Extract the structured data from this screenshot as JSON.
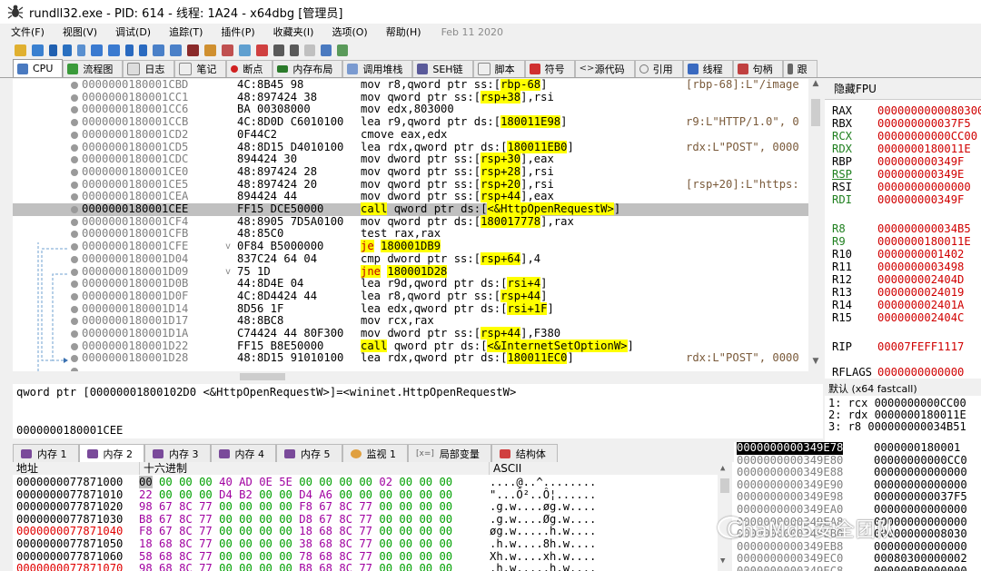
{
  "title": "rundll32.exe - PID: 614 - 线程: 1A24 - x64dbg [管理员]",
  "menu": [
    "文件(F)",
    "视图(V)",
    "调试(D)",
    "追踪(T)",
    "插件(P)",
    "收藏夹(I)",
    "选项(O)",
    "帮助(H)"
  ],
  "build_date": "Feb 11 2020",
  "tabs": [
    "CPU",
    "流程图",
    "日志",
    "笔记",
    "断点",
    "内存布局",
    "调用堆栈",
    "SEH链",
    "脚本",
    "符号",
    "源代码",
    "引用",
    "线程",
    "句柄",
    "跟"
  ],
  "disasm": [
    {
      "addr": "0000000180001CBD",
      "bytes": "4C:8B45 98",
      "ins": "mov r8,qword ptr ss:[rbp-68]",
      "cmt": "[rbp-68]:L\"/image"
    },
    {
      "addr": "0000000180001CC1",
      "bytes": "48:897424 38",
      "ins": "mov qword ptr ss:[rsp+38],rsi",
      "cmt": ""
    },
    {
      "addr": "0000000180001CC6",
      "bytes": "BA 00308000",
      "ins": "mov edx,803000",
      "cmt": ""
    },
    {
      "addr": "0000000180001CCB",
      "bytes": "4C:8D0D C6010100",
      "ins": "lea r9,qword ptr ds:[180011E98]",
      "cmt": "r9:L\"HTTP/1.0\", 0"
    },
    {
      "addr": "0000000180001CD2",
      "bytes": "0F44C2",
      "ins": "cmove eax,edx",
      "cmt": ""
    },
    {
      "addr": "0000000180001CD5",
      "bytes": "48:8D15 D4010100",
      "ins": "lea rdx,qword ptr ds:[180011EB0]",
      "cmt": "rdx:L\"POST\", 0000"
    },
    {
      "addr": "0000000180001CDC",
      "bytes": "894424 30",
      "ins": "mov dword ptr ss:[rsp+30],eax",
      "cmt": ""
    },
    {
      "addr": "0000000180001CE0",
      "bytes": "48:897424 28",
      "ins": "mov qword ptr ss:[rsp+28],rsi",
      "cmt": ""
    },
    {
      "addr": "0000000180001CE5",
      "bytes": "48:897424 20",
      "ins": "mov qword ptr ss:[rsp+20],rsi",
      "cmt": "[rsp+20]:L\"https:"
    },
    {
      "addr": "0000000180001CEA",
      "bytes": "894424 44",
      "ins": "mov dword ptr ss:[rsp+44],eax",
      "cmt": ""
    },
    {
      "addr": "0000000180001CEE",
      "bytes": "FF15 DCE50000",
      "ins": "call qword ptr ds:[<&HttpOpenRequestW>]",
      "cmt": ""
    },
    {
      "addr": "0000000180001CF4",
      "bytes": "48:8905 7D5A0100",
      "ins": "mov qword ptr ds:[180017778],rax",
      "cmt": ""
    },
    {
      "addr": "0000000180001CFB",
      "bytes": "48:85C0",
      "ins": "test rax,rax",
      "cmt": ""
    },
    {
      "addr": "0000000180001CFE",
      "bytes": "0F84 B5000000",
      "ins": "je 180001DB9",
      "cmt": ""
    },
    {
      "addr": "0000000180001D04",
      "bytes": "837C24 64 04",
      "ins": "cmp dword ptr ss:[rsp+64],4",
      "cmt": ""
    },
    {
      "addr": "0000000180001D09",
      "bytes": "75 1D",
      "ins": "jne 180001D28",
      "cmt": ""
    },
    {
      "addr": "0000000180001D0B",
      "bytes": "44:8D4E 04",
      "ins": "lea r9d,qword ptr ds:[rsi+4]",
      "cmt": ""
    },
    {
      "addr": "0000000180001D0F",
      "bytes": "4C:8D4424 44",
      "ins": "lea r8,qword ptr ss:[rsp+44]",
      "cmt": ""
    },
    {
      "addr": "0000000180001D14",
      "bytes": "8D56 1F",
      "ins": "lea edx,qword ptr ds:[rsi+1F]",
      "cmt": ""
    },
    {
      "addr": "0000000180001D17",
      "bytes": "48:8BC8",
      "ins": "mov rcx,rax",
      "cmt": ""
    },
    {
      "addr": "0000000180001D1A",
      "bytes": "C74424 44 80F300",
      "ins": "mov dword ptr ss:[rsp+44],F380",
      "cmt": ""
    },
    {
      "addr": "0000000180001D22",
      "bytes": "FF15 B8E50000",
      "ins": "call qword ptr ds:[<&InternetSetOptionW>]",
      "cmt": ""
    },
    {
      "addr": "0000000180001D28",
      "bytes": "48:8D15 91010100",
      "ins": "lea rdx,qword ptr ds:[180011EC0]",
      "cmt": "rdx:L\"POST\", 0000"
    }
  ],
  "fpu_label": "隐藏FPU",
  "registers": [
    {
      "n": "RAX",
      "v": "0000000000080300"
    },
    {
      "n": "RBX",
      "v": "000000000037F5"
    },
    {
      "n": "RCX",
      "v": "00000000000CC00"
    },
    {
      "n": "RDX",
      "v": "0000000180011E"
    },
    {
      "n": "RBP",
      "v": "000000000349F"
    },
    {
      "n": "RSP",
      "v": "000000000349E"
    },
    {
      "n": "RSI",
      "v": "00000000000000"
    },
    {
      "n": "RDI",
      "v": "000000000349F"
    },
    {
      "n": "R8",
      "v": "000000000034B5"
    },
    {
      "n": "R9",
      "v": "0000000180011E"
    },
    {
      "n": "R10",
      "v": "0000000001402"
    },
    {
      "n": "R11",
      "v": "0000000003498"
    },
    {
      "n": "R12",
      "v": "000000002404D"
    },
    {
      "n": "R13",
      "v": "0000000024019"
    },
    {
      "n": "R14",
      "v": "000000002401A"
    },
    {
      "n": "R15",
      "v": "000000002404C"
    },
    {
      "n": "RIP",
      "v": "00007FEFF1117"
    },
    {
      "n": "RFLAGS",
      "v": "0000000000000"
    }
  ],
  "info_line1": "qword ptr [00000001800102D0 <&HttpOpenRequestW>]=<wininet.HttpOpenRequestW>",
  "info_line2": "0000000180001CEE",
  "call_conv": "默认 (x64 fastcall)",
  "call_args": [
    "1: rcx 0000000000CC00",
    "2: rdx 0000000180011E",
    "3: r8 000000000034B51"
  ],
  "mem_tabs": [
    "内存 1",
    "内存 2",
    "内存 3",
    "内存 4",
    "内存 5",
    "监视 1",
    "局部变量",
    "结构体"
  ],
  "dump_headers": {
    "addr": "地址",
    "hex": "十六进制",
    "ascii": "ASCII"
  },
  "dump": [
    {
      "a": "0000000077871000",
      "h": "00 00 00 00 40 AD 0E 5E 00 00 00 00 02 00 00 00",
      "s": "....@..^........"
    },
    {
      "a": "0000000077871010",
      "h": "22 00 00 00 D4 B2 00 00 D4 A6 00 00 00 00 00 00",
      "s": "\"...Ô²..Ô¦......"
    },
    {
      "a": "0000000077871020",
      "h": "98 67 8C 77 00 00 00 00 F8 67 8C 77 00 00 00 00",
      "s": ".g.w....øg.w...."
    },
    {
      "a": "0000000077871030",
      "h": "B8 67 8C 77 00 00 00 00 D8 67 8C 77 00 00 00 00",
      "s": ".g.w....Øg.w...."
    },
    {
      "a": "0000000077871040",
      "h": "F8 67 8C 77 00 00 00 00 18 68 8C 77 00 00 00 00",
      "s": "øg.w.....h.w...."
    },
    {
      "a": "0000000077871050",
      "h": "18 68 8C 77 00 00 00 00 38 68 8C 77 00 00 00 00",
      "s": ".h.w....8h.w...."
    },
    {
      "a": "0000000077871060",
      "h": "58 68 8C 77 00 00 00 00 78 68 8C 77 00 00 00 00",
      "s": "Xh.w....xh.w...."
    },
    {
      "a": "0000000077871070",
      "h": "98 68 8C 77 00 00 00 00 B8 68 8C 77 00 00 00 00",
      "s": ".h.w.....h.w...."
    }
  ],
  "stack": [
    {
      "a": "0000000000349E78",
      "v": "0000000180001"
    },
    {
      "a": "0000000000349E80",
      "v": "00000000000CC0"
    },
    {
      "a": "0000000000349E88",
      "v": "00000000000000"
    },
    {
      "a": "0000000000349E90",
      "v": "00000000000000"
    },
    {
      "a": "0000000000349E98",
      "v": "000000000037F5"
    },
    {
      "a": "0000000000349EA0",
      "v": "00000000000000"
    },
    {
      "a": "0000000000349EA8",
      "v": "00000000000000"
    },
    {
      "a": "0000000000349EB0",
      "v": "00000000008030"
    },
    {
      "a": "0000000000349EB8",
      "v": "00000000000000"
    },
    {
      "a": "0000000000349EC0",
      "v": "00080300000002"
    },
    {
      "a": "0000000000349EC8",
      "v": "000000B0000000"
    }
  ],
  "watermark": "ChaMd5安全团队"
}
